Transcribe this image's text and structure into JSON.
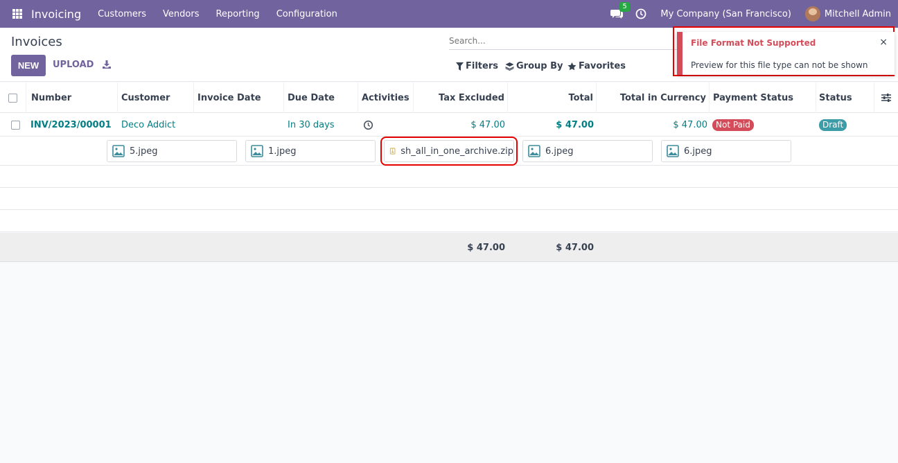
{
  "navbar": {
    "brand": "Invoicing",
    "menu": [
      "Customers",
      "Vendors",
      "Reporting",
      "Configuration"
    ],
    "chat_badge": "5",
    "company": "My Company (San Francisco)",
    "user": "Mitchell Admin"
  },
  "control": {
    "title": "Invoices",
    "new_label": "NEW",
    "upload_label": "UPLOAD",
    "search_placeholder": "Search...",
    "filters_label": "Filters",
    "groupby_label": "Group By",
    "favorites_label": "Favorites"
  },
  "table": {
    "columns": [
      "Number",
      "Customer",
      "Invoice Date",
      "Due Date",
      "Activities",
      "Tax Excluded",
      "Total",
      "Total in Currency",
      "Payment Status",
      "Status"
    ],
    "row": {
      "number": "INV/2023/00001",
      "customer": "Deco Addict",
      "invoice_date": "",
      "due_date": "In 30 days",
      "tax_excluded": "$ 47.00",
      "total": "$ 47.00",
      "total_currency": "$ 47.00",
      "payment_status": "Not Paid",
      "status": "Draft"
    },
    "attachments": [
      "5.jpeg",
      "1.jpeg",
      "sh_all_in_one_archive.zip",
      "6.jpeg",
      "6.jpeg"
    ],
    "footer": {
      "tax_excluded": "$ 47.00",
      "total": "$ 47.00"
    }
  },
  "notification": {
    "title": "File Format Not Supported",
    "message": "Preview for this file type can not be shown",
    "close": "×"
  },
  "colors": {
    "brand": "#71639e",
    "link": "#017e84",
    "danger": "#d44c59",
    "draft": "#3c9ca8"
  }
}
